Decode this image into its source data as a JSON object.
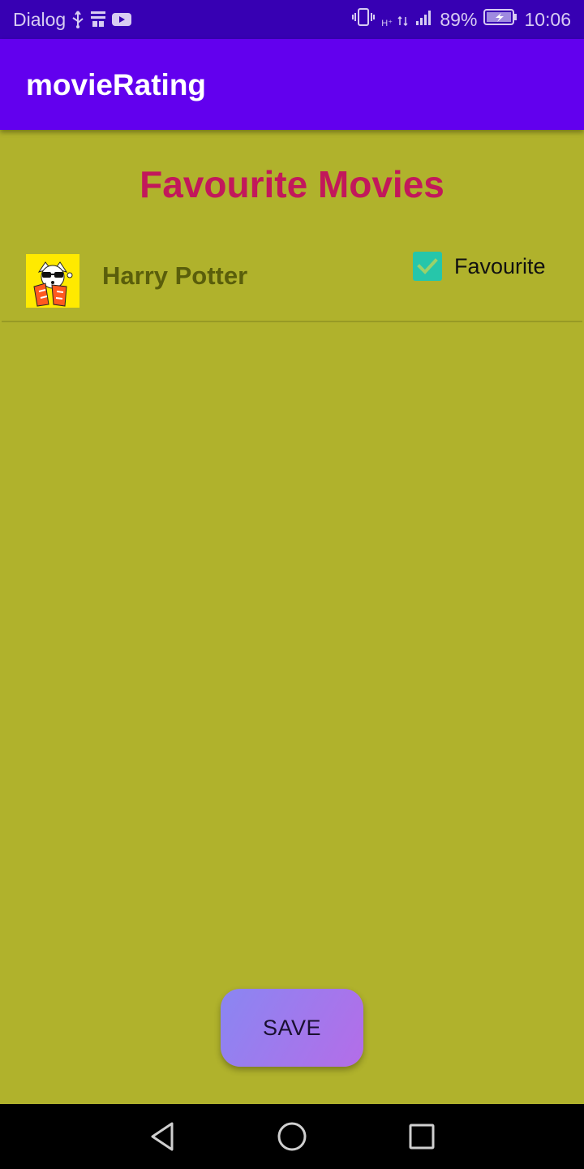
{
  "status_bar": {
    "left_text": "Dialog",
    "icons_left": [
      "usb-icon",
      "qr-notification-icon",
      "youtube-icon"
    ],
    "icons_right": [
      "vibrate-icon",
      "mobile-data-icon",
      "signal-icon",
      "battery-charging-icon"
    ],
    "network_type": "H⁺",
    "battery": "89%",
    "time": "10:06"
  },
  "app_bar": {
    "title": "movieRating"
  },
  "page": {
    "heading": "Favourite Movies"
  },
  "movies": [
    {
      "title": "Harry Potter",
      "favourite": true,
      "checkbox_label": "Favourite"
    }
  ],
  "save_button": {
    "label": "SAVE"
  },
  "nav_bar": {
    "buttons": [
      "back",
      "home",
      "recents"
    ]
  },
  "colors": {
    "status_bar": "#3700b3",
    "app_bar": "#6200ee",
    "background": "#b0b22c",
    "heading": "#c2185b",
    "movie_title": "#5a5e0b",
    "checkbox": "#26c6aa"
  }
}
